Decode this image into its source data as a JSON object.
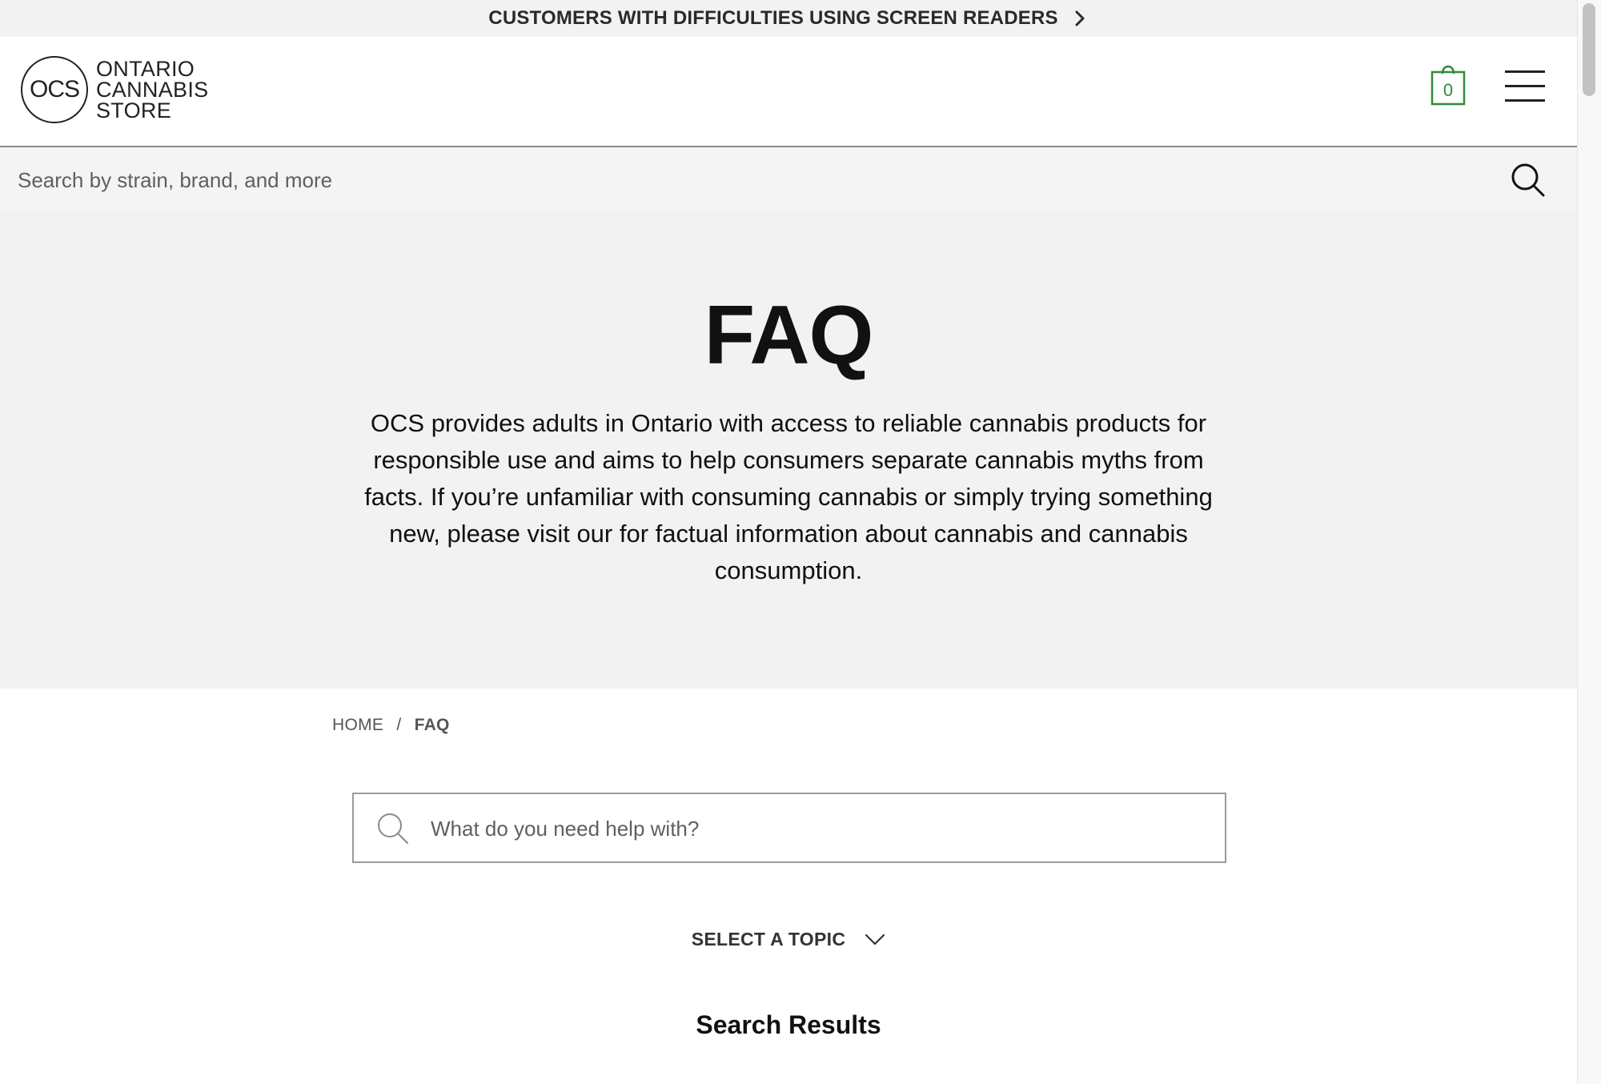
{
  "banner": {
    "text": "CUSTOMERS WITH DIFFICULTIES USING SCREEN READERS",
    "icon": "chevron-right-icon"
  },
  "header": {
    "logo_mark": "OCS",
    "logo_line1": "ONTARIO",
    "logo_line2": "CANNABIS",
    "logo_line3": "STORE",
    "cart_count": "0",
    "cart_color": "#2e8b3a",
    "menu_icon": "hamburger-menu-icon"
  },
  "search": {
    "placeholder": "Search by strain, brand, and more",
    "icon": "search-icon"
  },
  "hero": {
    "title": "FAQ",
    "description": "OCS provides adults in Ontario with access to reliable cannabis products for responsible use and aims to help consumers separate cannabis myths from facts. If you’re unfamiliar with consuming cannabis or simply trying something new, please visit our for factual information about cannabis and cannabis consumption."
  },
  "breadcrumb": {
    "home": "HOME",
    "separator": "/",
    "current": "FAQ"
  },
  "faq_search": {
    "placeholder": "What do you need help with?",
    "icon": "search-icon"
  },
  "topic": {
    "label": "SELECT A TOPIC",
    "icon": "chevron-down-icon"
  },
  "results": {
    "title": "Search Results"
  }
}
